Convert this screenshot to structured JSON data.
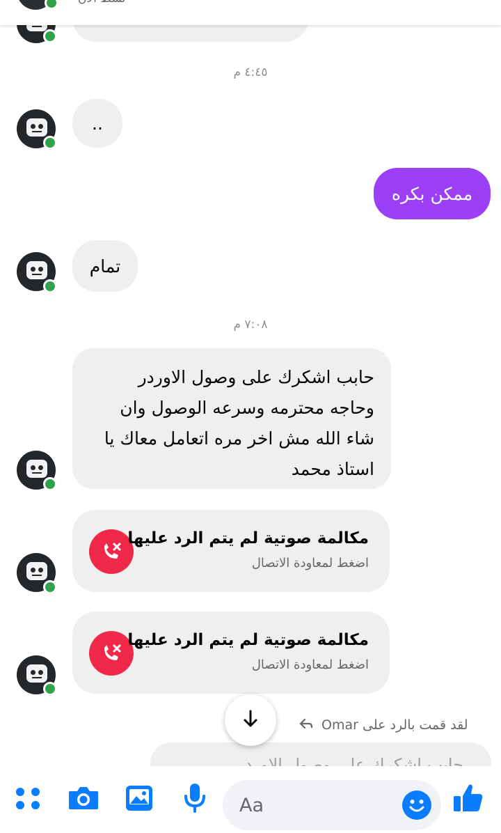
{
  "header": {
    "status_text": "نشط الآن"
  },
  "messages": {
    "partial_top": "",
    "time_1": "٤:٤٥ م",
    "msg_dots": "..",
    "msg_out_1": "ممكن بكره",
    "msg_tamam": "تمام",
    "time_2": "٧:٠٨ م",
    "msg_long": "حابب اشكرك على وصول الاوردر وحاجه محترمه وسرعه الوصول وان شاء الله مش اخر مره اتعامل معاك يا استاذ محمد",
    "missed_call_title": "مكالمة صوتية لم يتم الرد عليها",
    "missed_call_subtitle": "اضغط لمعاودة الاتصال",
    "reply_note": "لقد قمت بالرد على Omar",
    "reply_quote_partial": "حابب اشكرك على وصول الاوردر"
  },
  "composer": {
    "placeholder": "Aa"
  },
  "colors": {
    "accent": "#0a7cff",
    "outgoing_bubble": "#9b40f5",
    "incoming_bubble": "#efefef",
    "missed_call": "#f02849",
    "online": "#31a24c"
  },
  "icons": [
    "menu-dots-icon",
    "camera-icon",
    "gallery-icon",
    "microphone-icon",
    "emoji-icon",
    "like-icon",
    "missed-call-icon",
    "arrow-down-icon",
    "reply-arrow-icon"
  ]
}
